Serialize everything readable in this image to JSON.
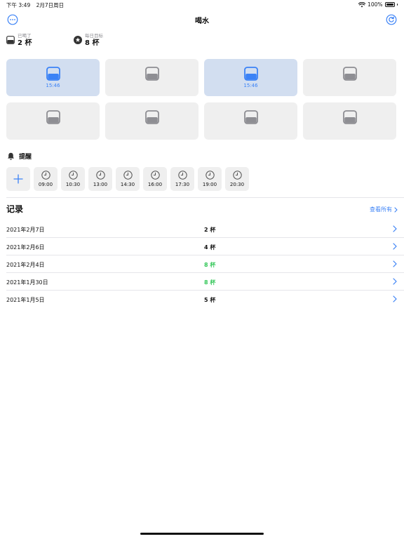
{
  "status_bar": {
    "time": "下午 3:49",
    "date": "2月7日周日",
    "battery": "100%"
  },
  "nav": {
    "title": "喝水",
    "left_icon": "ellipsis-circle-icon",
    "right_icon": "refresh-icon"
  },
  "stats": {
    "drank_label": "已喝了",
    "drank_value": "2 杯",
    "goal_label": "每日目标",
    "goal_value": "8 杯"
  },
  "cups": [
    {
      "filled": true,
      "time": "15:46"
    },
    {
      "filled": false,
      "time": ""
    },
    {
      "filled": true,
      "time": "15:46"
    },
    {
      "filled": false,
      "time": ""
    },
    {
      "filled": false,
      "time": ""
    },
    {
      "filled": false,
      "time": ""
    },
    {
      "filled": false,
      "time": ""
    },
    {
      "filled": false,
      "time": ""
    }
  ],
  "reminders": {
    "title": "提醒",
    "times": [
      "09:00",
      "10:30",
      "13:00",
      "14:30",
      "16:00",
      "17:30",
      "19:00",
      "20:30"
    ]
  },
  "records": {
    "title": "记录",
    "see_all": "查看所有",
    "rows": [
      {
        "date": "2021年2月7日",
        "count": "2 杯",
        "goal_met": false
      },
      {
        "date": "2021年2月6日",
        "count": "4 杯",
        "goal_met": false
      },
      {
        "date": "2021年2月4日",
        "count": "8 杯",
        "goal_met": true
      },
      {
        "date": "2021年1月30日",
        "count": "8 杯",
        "goal_met": true
      },
      {
        "date": "2021年1月5日",
        "count": "5 杯",
        "goal_met": false
      }
    ]
  },
  "colors": {
    "accent": "#3b82f6",
    "success": "#34c759",
    "cell_bg": "#efefef",
    "cell_filled_bg": "#d2def0"
  }
}
